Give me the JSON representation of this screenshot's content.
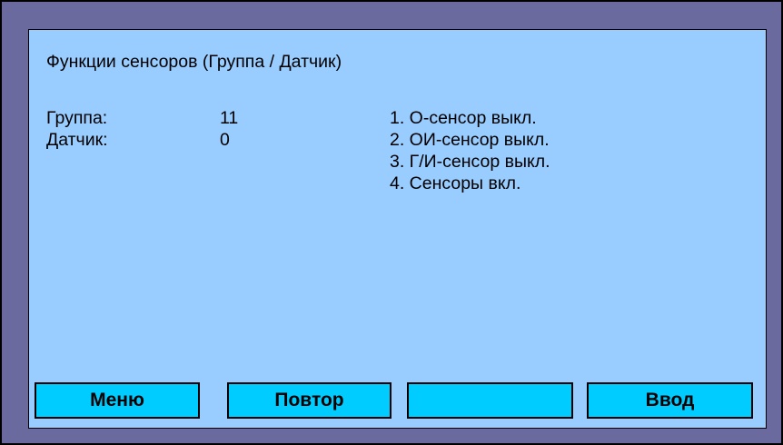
{
  "screen": {
    "title": "Функции сенсоров (Группа / Датчик)",
    "fields": [
      {
        "label": "Группа:",
        "value": "11"
      },
      {
        "label": "Датчик:",
        "value": "0"
      }
    ],
    "options": [
      "1. О-сенсор выкл.",
      "2. ОИ-сенсор выкл.",
      "3. Г/И-сенсор выкл.",
      "4. Сенсоры вкл."
    ]
  },
  "softkeys": {
    "menu": "Меню",
    "repeat": "Повтор",
    "empty": "",
    "enter": "Ввод"
  },
  "colors": {
    "outer_frame": "#6a6a9e",
    "screen_background": "#99ccff",
    "button_background": "#00ccff"
  }
}
